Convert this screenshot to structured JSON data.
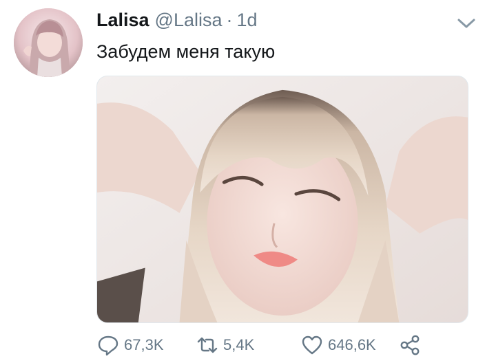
{
  "tweet": {
    "author": {
      "name": "Lalisa",
      "handle": "@Lalisa",
      "separator": "·",
      "time": "1d"
    },
    "text": "Забудем меня такую",
    "stats": {
      "replies": "67,3K",
      "retweets": "5,4K",
      "likes": "646,6K"
    }
  },
  "icons": {
    "menu": "chevron-down-icon",
    "reply": "reply-icon",
    "retweet": "retweet-icon",
    "like": "heart-icon",
    "share": "share-icon"
  },
  "colors": {
    "text": "#14171a",
    "secondary": "#657786",
    "border": "#e1e8ed"
  }
}
